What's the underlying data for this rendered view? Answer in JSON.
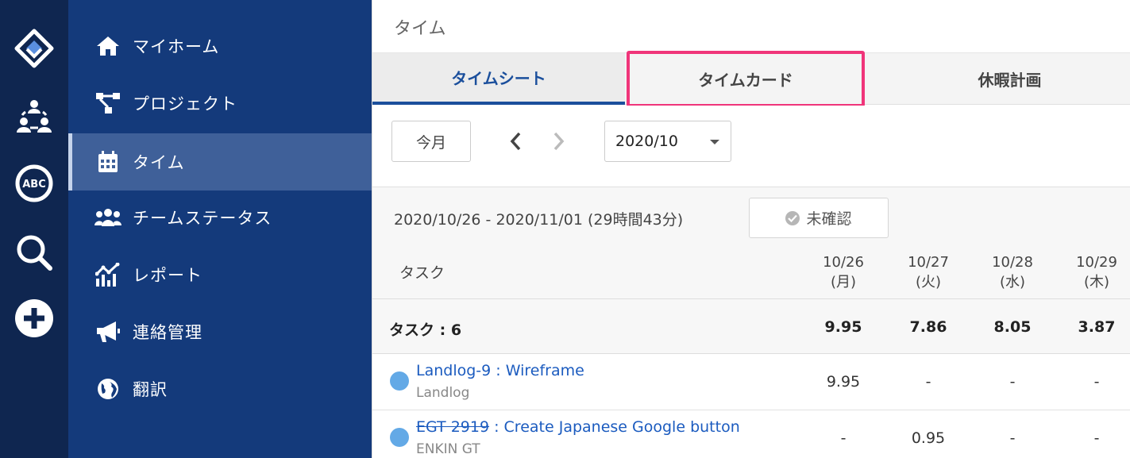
{
  "page": {
    "title": "タイム"
  },
  "rail": {
    "icons": [
      "logo-icon",
      "team-icon",
      "abc-icon",
      "search-icon",
      "add-icon"
    ]
  },
  "sidebar": {
    "items": [
      {
        "label": "マイホーム",
        "icon": "home-icon",
        "active": false
      },
      {
        "label": "プロジェクト",
        "icon": "project-tree-icon",
        "active": false
      },
      {
        "label": "タイム",
        "icon": "calendar-icon",
        "active": true
      },
      {
        "label": "チームステータス",
        "icon": "users-icon",
        "active": false
      },
      {
        "label": "レポート",
        "icon": "chart-icon",
        "active": false
      },
      {
        "label": "連絡管理",
        "icon": "megaphone-icon",
        "active": false
      },
      {
        "label": "翻訳",
        "icon": "globe-icon",
        "active": false
      }
    ]
  },
  "tabs": [
    {
      "label": "タイムシート",
      "active": true
    },
    {
      "label": "タイムカード",
      "active": false,
      "highlighted": true
    },
    {
      "label": "休暇計画",
      "active": false
    }
  ],
  "toolbar": {
    "this_month_label": "今月",
    "month_select_value": "2020/10"
  },
  "timesheet": {
    "range_label": "2020/10/26 - 2020/11/01 (29時間43分)",
    "status_label": "未確認",
    "task_header": "タスク",
    "days": [
      {
        "date": "10/26",
        "weekday": "(月)"
      },
      {
        "date": "10/27",
        "weekday": "(火)"
      },
      {
        "date": "10/28",
        "weekday": "(水)"
      },
      {
        "date": "10/29",
        "weekday": "(木)"
      }
    ],
    "summary": {
      "label": "タスク : 6",
      "values": [
        "9.95",
        "7.86",
        "8.05",
        "3.87"
      ]
    },
    "rows": [
      {
        "id": "Landlog-9",
        "id_struck": false,
        "title": " : Wireframe",
        "project": "Landlog",
        "values": [
          "9.95",
          "-",
          "-",
          "-"
        ]
      },
      {
        "id": "EGT 2919",
        "id_struck": true,
        "title": " : Create Japanese Google button",
        "project": "ENKIN GT",
        "values": [
          "-",
          "0.95",
          "-",
          "-"
        ]
      }
    ]
  },
  "colors": {
    "rail": "#0f2650",
    "sidebar": "#143a7b",
    "sidebar_active": "#3f6099",
    "tab_active": "#1b4f9c",
    "highlight": "#f0357a",
    "task_dot": "#63a9e6"
  }
}
